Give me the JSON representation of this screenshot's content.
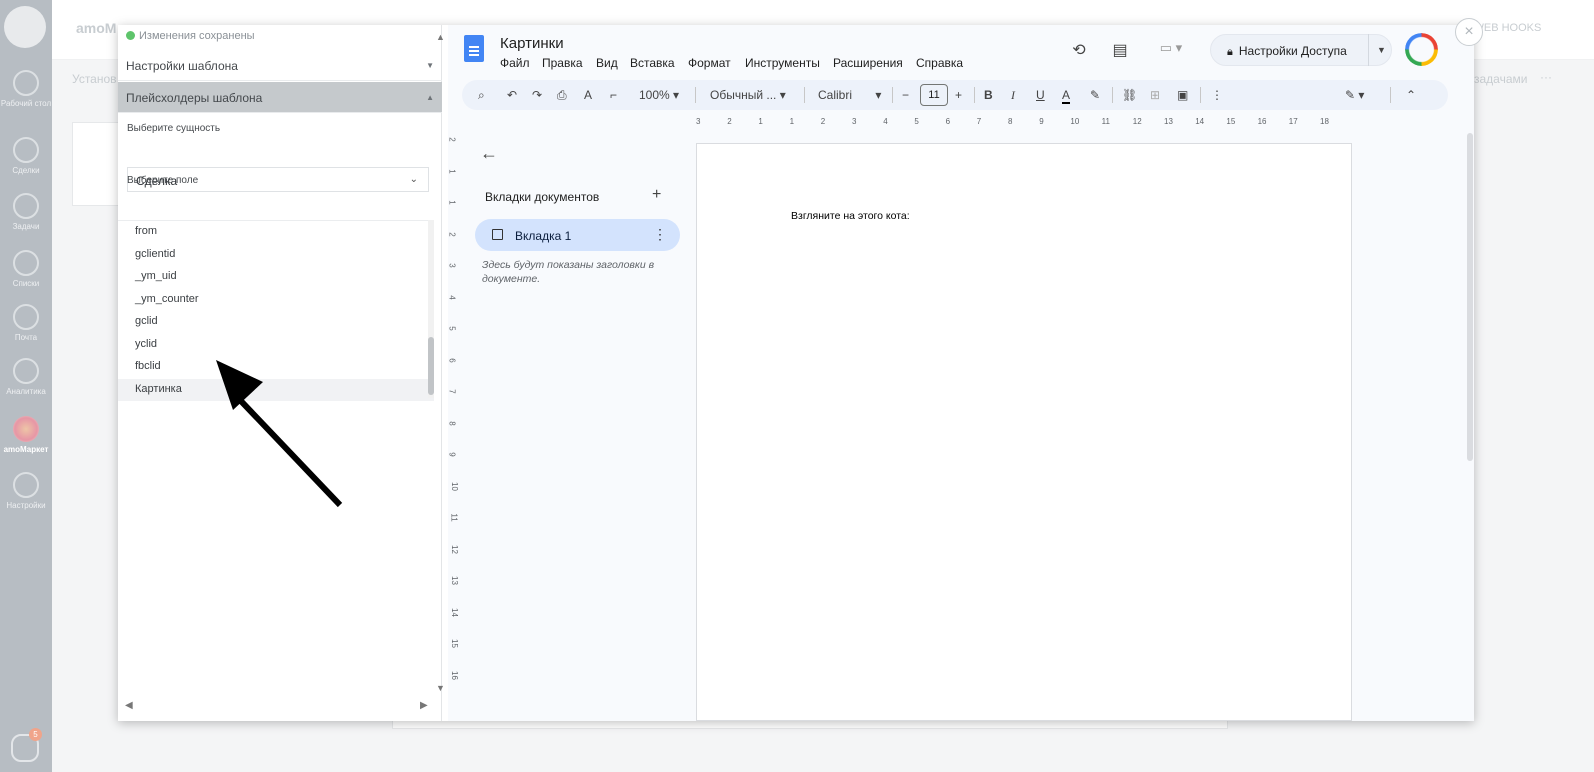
{
  "amo_sidebar": {
    "items": [
      {
        "label": "Рабочий стол",
        "icon": "dashboard-icon"
      },
      {
        "label": "Сделки",
        "icon": "dollar-icon"
      },
      {
        "label": "Задачи",
        "icon": "check-icon"
      },
      {
        "label": "Списки",
        "icon": "list-icon"
      },
      {
        "label": "Почта",
        "icon": "mail-icon"
      },
      {
        "label": "Аналитика",
        "icon": "analytics-icon"
      },
      {
        "label": "amoМаркет",
        "icon": "market-icon"
      },
      {
        "label": "Настройки",
        "icon": "wrench-icon"
      }
    ],
    "chat_badge": "5"
  },
  "background": {
    "app_title": "amoM",
    "webhooks_label": "+ WEB HOOKS",
    "tab_left": "Установ",
    "tab_right": "задачами",
    "more": "···"
  },
  "left_panel": {
    "status": "Изменения сохранены",
    "sections": {
      "template_settings": "Настройки шаблона",
      "template_placeholders": "Плейсхолдеры шаблона"
    },
    "entity_label": "Выберите сущность",
    "entity_value": "Сделка",
    "field_label": "Выберите поле",
    "fields": [
      "from",
      "gclientid",
      "_ym_uid",
      "_ym_counter",
      "gclid",
      "yclid",
      "fbclid",
      "Картинка"
    ],
    "selected_field": "Картинка"
  },
  "docs": {
    "title": "Картинки",
    "menu": [
      "Файл",
      "Правка",
      "Вид",
      "Вставка",
      "Формат",
      "Инструменты",
      "Расширения",
      "Справка"
    ],
    "share_label": "Настройки Доступа",
    "toolbar": {
      "zoom": "100%",
      "style": "Обычный ...",
      "font": "Calibri",
      "font_size": "11"
    },
    "ruler_h": [
      "3",
      "2",
      "1",
      "1",
      "2",
      "3",
      "4",
      "5",
      "6",
      "7",
      "8",
      "9",
      "10",
      "11",
      "12",
      "13",
      "14",
      "15",
      "16",
      "17",
      "18"
    ],
    "ruler_v": [
      "2",
      "1",
      "1",
      "2",
      "3",
      "4",
      "5",
      "6",
      "7",
      "8",
      "9",
      "10",
      "11",
      "12",
      "13",
      "14",
      "15",
      "16"
    ],
    "outline": {
      "title": "Вкладки документов",
      "tab_label": "Вкладка 1",
      "hint": "Здесь будут показаны заголовки в документе."
    },
    "page_text": "Взгляните на этого кота:"
  }
}
